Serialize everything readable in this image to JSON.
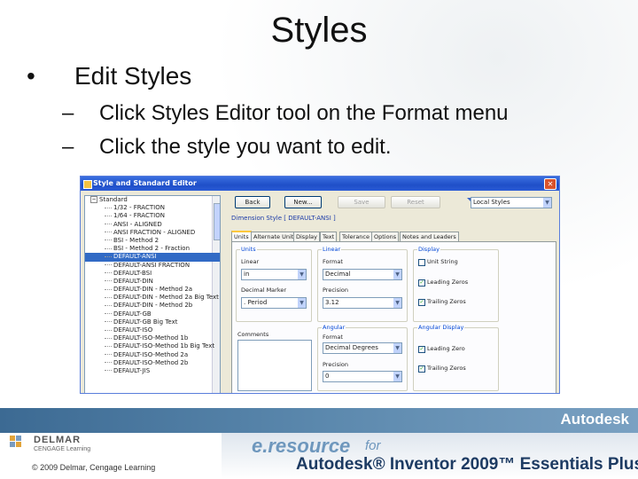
{
  "slide": {
    "title": "Styles",
    "bullet_marker": "•",
    "bullet": "Edit Styles",
    "sub_marker": "–",
    "subbullets": [
      "Click Styles Editor tool on the Format menu",
      "Click the style you want to edit."
    ]
  },
  "dialog": {
    "title": "Style and Standard Editor",
    "tree": [
      {
        "label": "Standard",
        "root": true
      },
      {
        "label": "1/32 - FRACTION"
      },
      {
        "label": "1/64 - FRACTION"
      },
      {
        "label": "ANSI - ALIGNED"
      },
      {
        "label": "ANSI FRACTION - ALIGNED"
      },
      {
        "label": "BSI - Method 2"
      },
      {
        "label": "BSI - Method 2 - Fraction"
      },
      {
        "label": "DEFAULT-ANSI",
        "selected": true
      },
      {
        "label": "DEFAULT-ANSI FRACTION"
      },
      {
        "label": "DEFAULT-BSI"
      },
      {
        "label": "DEFAULT-DIN"
      },
      {
        "label": "DEFAULT-DIN - Method 2a"
      },
      {
        "label": "DEFAULT-DIN - Method 2a Big Text"
      },
      {
        "label": "DEFAULT-DIN - Method 2b"
      },
      {
        "label": "DEFAULT-GB"
      },
      {
        "label": "DEFAULT-GB Big Text"
      },
      {
        "label": "DEFAULT-ISO"
      },
      {
        "label": "DEFAULT-ISO-Method 1b"
      },
      {
        "label": "DEFAULT-ISO-Method 1b Big Text"
      },
      {
        "label": "DEFAULT-ISO-Method 2a"
      },
      {
        "label": "DEFAULT-ISO-Method 2b"
      },
      {
        "label": "DEFAULT-JIS"
      }
    ],
    "buttons": {
      "back": "Back",
      "new": "New...",
      "save": "Save",
      "reset": "Reset"
    },
    "filter": "Local Styles",
    "style_heading": "Dimension Style [ DEFAULT-ANSI ]",
    "tabs": [
      "Units",
      "Alternate Units",
      "Display",
      "Text",
      "Tolerance",
      "Options",
      "Notes and Leaders"
    ],
    "units": {
      "group": "Units",
      "linear_label": "Linear",
      "linear_value": "in",
      "marker_label": "Decimal Marker",
      "marker_value": ". Period"
    },
    "linear": {
      "group": "Linear",
      "format_label": "Format",
      "format_value": "Decimal",
      "precision_label": "Precision",
      "precision_value": "3.12"
    },
    "display": {
      "group": "Display",
      "unit_string": "Unit String",
      "leading_zero": "Leading Zeros",
      "trailing_zeros": "Trailing Zeros"
    },
    "comments_label": "Comments",
    "angular": {
      "group": "Angular",
      "format_label": "Format",
      "format_value": "Decimal Degrees",
      "precision_label": "Precision",
      "precision_value": "0"
    },
    "angular_display": {
      "group": "Angular Display",
      "leading_zero": "Leading Zero",
      "trailing_zeros": "Trailing Zeros"
    }
  },
  "footer": {
    "autodesk": "Autodesk",
    "delmar": "DELMAR",
    "cengage": "CENGAGE Learning",
    "copyright": "© 2009 Delmar, Cengage Learning",
    "eresource": "e.resource",
    "for": "for",
    "product": "Autodesk® Inventor 2009™ Essentials Plus"
  },
  "colors": {
    "band": "#4f7ea6",
    "window_title": "#2458d3",
    "selection": "#316ac5"
  }
}
